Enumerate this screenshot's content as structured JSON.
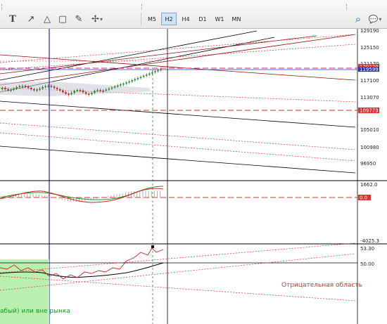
{
  "toolbar": {
    "tools": [
      {
        "name": "text-tool",
        "glyph": "T"
      },
      {
        "name": "arrow-tool",
        "glyph": "↗"
      },
      {
        "name": "triangle-tool",
        "glyph": "△"
      },
      {
        "name": "rectangle-tool",
        "glyph": "▢"
      },
      {
        "name": "brush-tool",
        "glyph": "✎"
      },
      {
        "name": "shapes-tool",
        "glyph": "✢"
      }
    ],
    "timeframes": [
      "M5",
      "H2",
      "H4",
      "D1",
      "W1",
      "MN"
    ],
    "active_timeframe": "H2",
    "right_icons": [
      {
        "name": "search-icon",
        "glyph": "⌕"
      },
      {
        "name": "chat-icon",
        "glyph": "💬"
      }
    ]
  },
  "price_axis": {
    "labels": [
      "129190",
      "125150",
      "121170",
      "117100",
      "113070",
      "109040",
      "105010",
      "100980",
      "96950"
    ],
    "current_price_tag": "120229",
    "current_price_tag_2": "119599",
    "level_tag": "109773"
  },
  "macd_axis": {
    "top_label": "1662.0",
    "zero_label": "0.0",
    "bottom_label": "-4025.3"
  },
  "rsi_axis": {
    "top_label": "53.30",
    "mid_label": "50.00"
  },
  "annotations": {
    "negative_zone": "Отрицательная область",
    "market_note": "абый) или вне рынка"
  },
  "colors": {
    "price_line": "#2a2ae0",
    "level_red": "#e03030",
    "bull_candle": "#1a9a1a",
    "bear_candle": "#d22020",
    "green_zone": "#b9f0b0",
    "vline_blue": "#1c28c8"
  },
  "chart_data": {
    "type": "candlestick",
    "timeframe": "H2",
    "y_ticks": [
      129190,
      125150,
      121170,
      117100,
      113070,
      109040,
      105010,
      100980,
      96950
    ],
    "current_price": 120229,
    "level_price": 109773,
    "indicators": [
      "MACD",
      "RSI"
    ]
  }
}
